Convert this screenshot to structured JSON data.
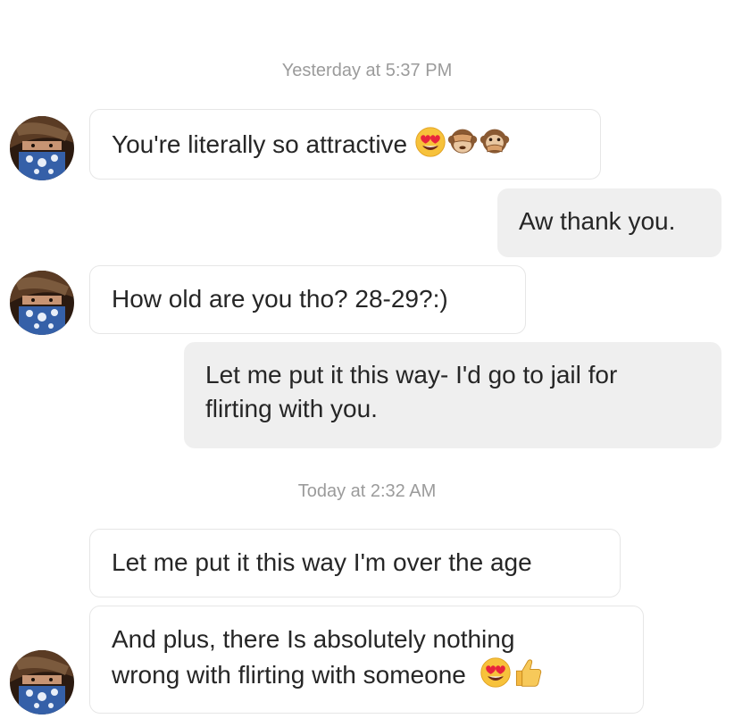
{
  "timestamps": {
    "first": "Yesterday at 5:37 PM",
    "second": "Today at 2:32 AM"
  },
  "messages": [
    {
      "side": "incoming",
      "text": "You're literally so attractive",
      "emoji": [
        "smiling-face-heart-eyes",
        "see-no-evil-monkey",
        "speak-no-evil-monkey"
      ]
    },
    {
      "side": "outgoing",
      "text": "Aw thank you."
    },
    {
      "side": "incoming",
      "text": "How old are you tho? 28-29?:)"
    },
    {
      "side": "outgoing",
      "line1": "Let me put it this way- I'd go to jail for",
      "line2": "flirting with you."
    },
    {
      "side": "incoming",
      "text": "Let me put it this way I'm over the age"
    },
    {
      "side": "incoming",
      "line1": "And plus, there Is absolutely nothing",
      "line2": "wrong with flirting with someone",
      "emoji": [
        "smiling-face-heart-eyes",
        "thumbs-up"
      ]
    }
  ],
  "colors": {
    "incoming_bg": "#ffffff",
    "incoming_border": "#e6e6e6",
    "outgoing_bg": "#efefef",
    "timestamp": "#9b9b9b",
    "text": "#262626"
  }
}
